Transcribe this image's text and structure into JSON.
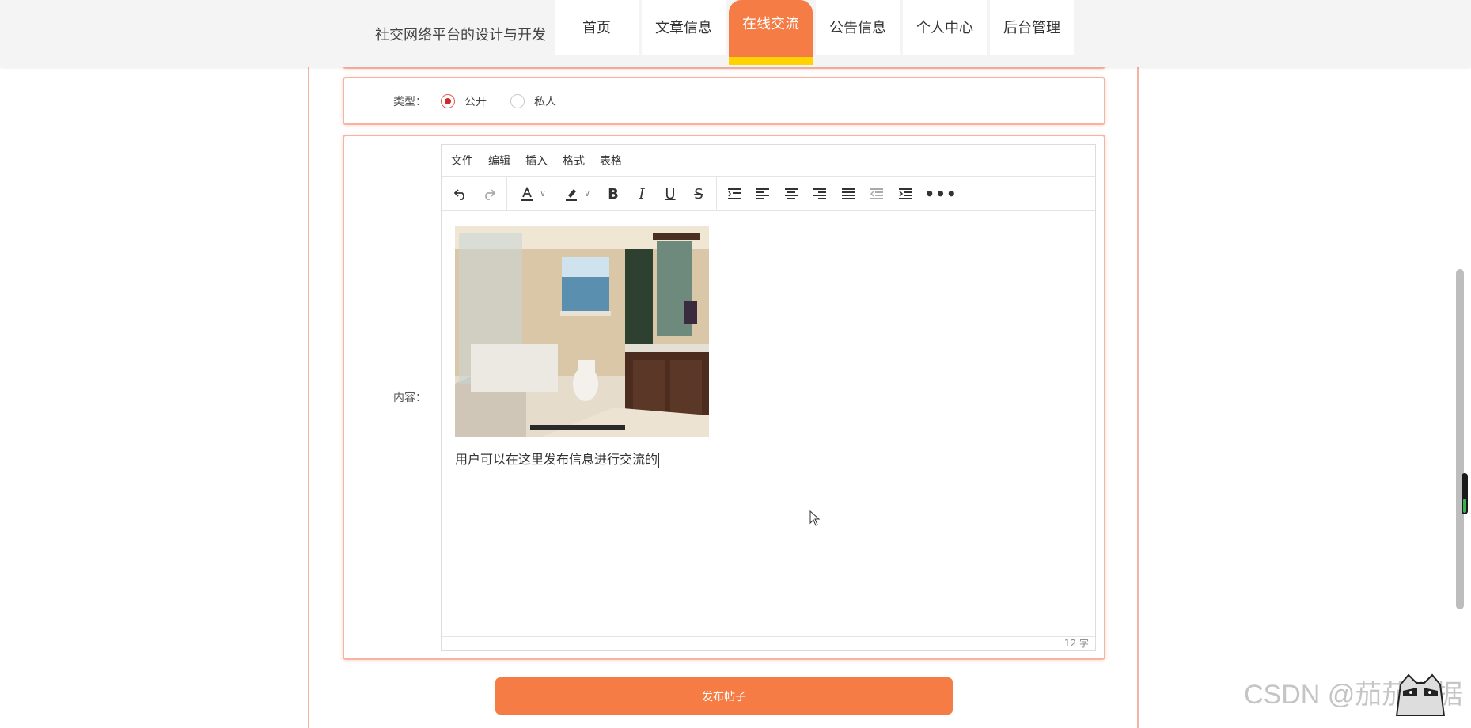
{
  "header": {
    "site_title": "社交网络平台的设计与开发",
    "nav": [
      {
        "label": "首页",
        "active": false
      },
      {
        "label": "文章信息",
        "active": false
      },
      {
        "label": "在线交流",
        "active": true
      },
      {
        "label": "公告信息",
        "active": false
      },
      {
        "label": "个人中心",
        "active": false
      },
      {
        "label": "后台管理",
        "active": false
      }
    ]
  },
  "form": {
    "type_label": "类型：",
    "type_options": [
      {
        "label": "公开",
        "checked": true
      },
      {
        "label": "私人",
        "checked": false
      }
    ],
    "content_label": "内容："
  },
  "editor": {
    "menu": [
      "文件",
      "编辑",
      "插入",
      "格式",
      "表格"
    ],
    "toolbar_icons": [
      "undo-icon",
      "redo-icon",
      "text-color-icon",
      "highlight-color-icon",
      "bold-icon",
      "italic-icon",
      "underline-icon",
      "strikethrough-icon",
      "line-height-icon",
      "align-left-icon",
      "align-center-icon",
      "align-right-icon",
      "align-justify-icon",
      "outdent-icon",
      "indent-icon",
      "more-icon"
    ],
    "content_text": "用户可以在这里发布信息进行交流的",
    "word_count": "12 字"
  },
  "actions": {
    "publish_label": "发布帖子"
  },
  "watermark": "CSDN @茄茄数据",
  "colors": {
    "accent": "#f57d45",
    "accent_border": "#f6b3a4",
    "active_underline": "#ffd200",
    "radio_checked": "#d02929"
  }
}
